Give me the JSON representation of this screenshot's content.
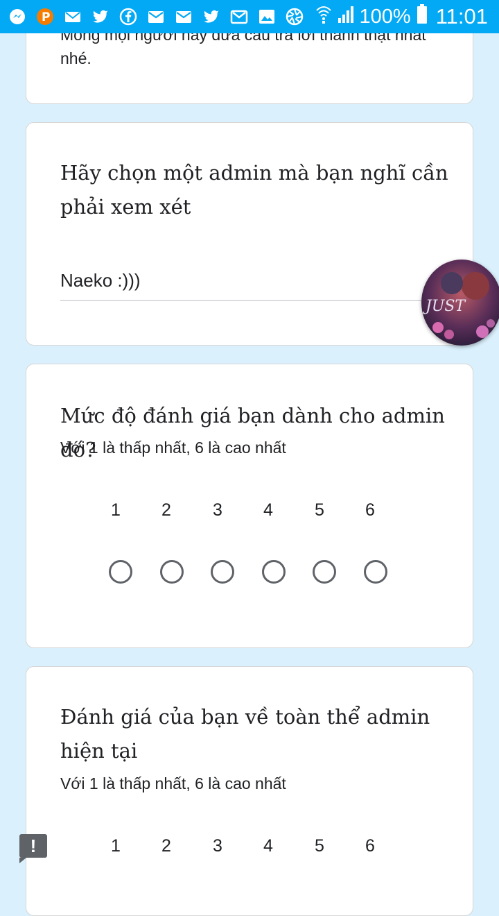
{
  "status_bar": {
    "battery_pct": "100%",
    "time": "11:01",
    "notification_icons": [
      "messenger-icon",
      "p-app-icon",
      "mail-icon",
      "twitter-icon",
      "facebook-icon",
      "email-icon",
      "email-icon",
      "twitter-icon",
      "gmail-icon",
      "gallery-icon",
      "aperture-icon"
    ]
  },
  "card1": {
    "text": "Mong mọi người hãy đưa câu trả lời thành thật nhất nhé."
  },
  "card2": {
    "question": "Hãy chọn một admin mà bạn nghĩ cần phải xem xét",
    "answer": "Naeko :)))"
  },
  "card3": {
    "question": "Mức độ đánh giá bạn dành cho admin đó?",
    "helper": "Với 1 là thấp nhất, 6 là cao nhất",
    "scale": [
      "1",
      "2",
      "3",
      "4",
      "5",
      "6"
    ]
  },
  "card4": {
    "question": "Đánh giá của bạn về toàn thể admin hiện tại",
    "helper": "Với 1 là thấp nhất, 6 là cao nhất",
    "scale": [
      "1",
      "2",
      "3",
      "4",
      "5",
      "6"
    ]
  },
  "feedback_badge": "!",
  "avatar": {
    "caption": "JUST"
  },
  "colors": {
    "status_bar": "#03a9f4",
    "background": "#daf0fc",
    "card": "#ffffff",
    "radio_border": "#5f6368"
  }
}
